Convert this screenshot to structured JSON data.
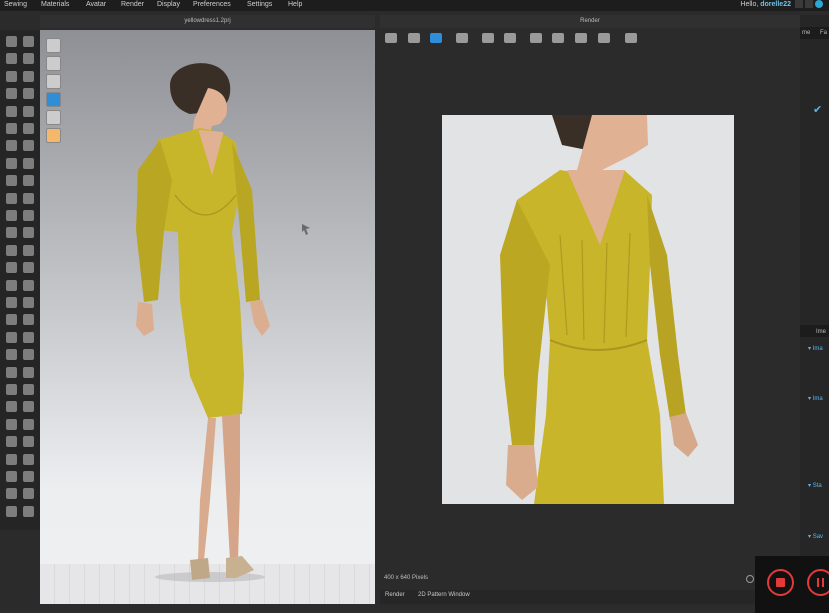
{
  "menu": [
    "Sewing",
    "Materials",
    "Avatar",
    "Render",
    "Display",
    "Preferences",
    "Settings",
    "Help"
  ],
  "user": {
    "greeting": "Hello,",
    "name": "dorelle22"
  },
  "viewport": {
    "title": "yellowdress1.2prj"
  },
  "render": {
    "title": "Render",
    "resolution": "400 x 640 Pixels"
  },
  "bottom_tabs": [
    "Render",
    "2D Pattern Window"
  ],
  "right_panel": {
    "tab_labels": [
      "me",
      "Fa"
    ],
    "section_label": "Ime",
    "items": [
      "Ima",
      "Ima",
      "Sta",
      "Sav"
    ]
  },
  "colors": {
    "dress": "#c7b52a",
    "accent": "#2e8fd8",
    "record": "#e23a3a"
  }
}
